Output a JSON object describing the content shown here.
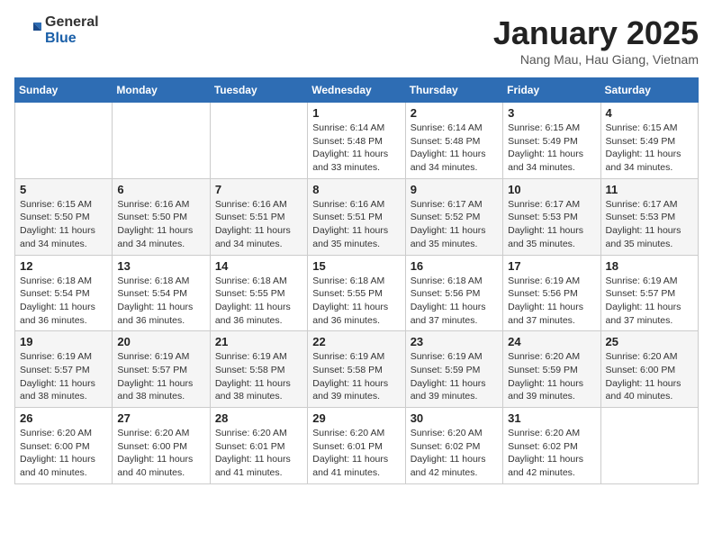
{
  "header": {
    "logo": {
      "general": "General",
      "blue": "Blue"
    },
    "title": "January 2025",
    "subtitle": "Nang Mau, Hau Giang, Vietnam"
  },
  "weekdays": [
    "Sunday",
    "Monday",
    "Tuesday",
    "Wednesday",
    "Thursday",
    "Friday",
    "Saturday"
  ],
  "weeks": [
    [
      {
        "day": "",
        "info": ""
      },
      {
        "day": "",
        "info": ""
      },
      {
        "day": "",
        "info": ""
      },
      {
        "day": "1",
        "info": "Sunrise: 6:14 AM\nSunset: 5:48 PM\nDaylight: 11 hours\nand 33 minutes."
      },
      {
        "day": "2",
        "info": "Sunrise: 6:14 AM\nSunset: 5:48 PM\nDaylight: 11 hours\nand 34 minutes."
      },
      {
        "day": "3",
        "info": "Sunrise: 6:15 AM\nSunset: 5:49 PM\nDaylight: 11 hours\nand 34 minutes."
      },
      {
        "day": "4",
        "info": "Sunrise: 6:15 AM\nSunset: 5:49 PM\nDaylight: 11 hours\nand 34 minutes."
      }
    ],
    [
      {
        "day": "5",
        "info": "Sunrise: 6:15 AM\nSunset: 5:50 PM\nDaylight: 11 hours\nand 34 minutes."
      },
      {
        "day": "6",
        "info": "Sunrise: 6:16 AM\nSunset: 5:50 PM\nDaylight: 11 hours\nand 34 minutes."
      },
      {
        "day": "7",
        "info": "Sunrise: 6:16 AM\nSunset: 5:51 PM\nDaylight: 11 hours\nand 34 minutes."
      },
      {
        "day": "8",
        "info": "Sunrise: 6:16 AM\nSunset: 5:51 PM\nDaylight: 11 hours\nand 35 minutes."
      },
      {
        "day": "9",
        "info": "Sunrise: 6:17 AM\nSunset: 5:52 PM\nDaylight: 11 hours\nand 35 minutes."
      },
      {
        "day": "10",
        "info": "Sunrise: 6:17 AM\nSunset: 5:53 PM\nDaylight: 11 hours\nand 35 minutes."
      },
      {
        "day": "11",
        "info": "Sunrise: 6:17 AM\nSunset: 5:53 PM\nDaylight: 11 hours\nand 35 minutes."
      }
    ],
    [
      {
        "day": "12",
        "info": "Sunrise: 6:18 AM\nSunset: 5:54 PM\nDaylight: 11 hours\nand 36 minutes."
      },
      {
        "day": "13",
        "info": "Sunrise: 6:18 AM\nSunset: 5:54 PM\nDaylight: 11 hours\nand 36 minutes."
      },
      {
        "day": "14",
        "info": "Sunrise: 6:18 AM\nSunset: 5:55 PM\nDaylight: 11 hours\nand 36 minutes."
      },
      {
        "day": "15",
        "info": "Sunrise: 6:18 AM\nSunset: 5:55 PM\nDaylight: 11 hours\nand 36 minutes."
      },
      {
        "day": "16",
        "info": "Sunrise: 6:18 AM\nSunset: 5:56 PM\nDaylight: 11 hours\nand 37 minutes."
      },
      {
        "day": "17",
        "info": "Sunrise: 6:19 AM\nSunset: 5:56 PM\nDaylight: 11 hours\nand 37 minutes."
      },
      {
        "day": "18",
        "info": "Sunrise: 6:19 AM\nSunset: 5:57 PM\nDaylight: 11 hours\nand 37 minutes."
      }
    ],
    [
      {
        "day": "19",
        "info": "Sunrise: 6:19 AM\nSunset: 5:57 PM\nDaylight: 11 hours\nand 38 minutes."
      },
      {
        "day": "20",
        "info": "Sunrise: 6:19 AM\nSunset: 5:57 PM\nDaylight: 11 hours\nand 38 minutes."
      },
      {
        "day": "21",
        "info": "Sunrise: 6:19 AM\nSunset: 5:58 PM\nDaylight: 11 hours\nand 38 minutes."
      },
      {
        "day": "22",
        "info": "Sunrise: 6:19 AM\nSunset: 5:58 PM\nDaylight: 11 hours\nand 39 minutes."
      },
      {
        "day": "23",
        "info": "Sunrise: 6:19 AM\nSunset: 5:59 PM\nDaylight: 11 hours\nand 39 minutes."
      },
      {
        "day": "24",
        "info": "Sunrise: 6:20 AM\nSunset: 5:59 PM\nDaylight: 11 hours\nand 39 minutes."
      },
      {
        "day": "25",
        "info": "Sunrise: 6:20 AM\nSunset: 6:00 PM\nDaylight: 11 hours\nand 40 minutes."
      }
    ],
    [
      {
        "day": "26",
        "info": "Sunrise: 6:20 AM\nSunset: 6:00 PM\nDaylight: 11 hours\nand 40 minutes."
      },
      {
        "day": "27",
        "info": "Sunrise: 6:20 AM\nSunset: 6:00 PM\nDaylight: 11 hours\nand 40 minutes."
      },
      {
        "day": "28",
        "info": "Sunrise: 6:20 AM\nSunset: 6:01 PM\nDaylight: 11 hours\nand 41 minutes."
      },
      {
        "day": "29",
        "info": "Sunrise: 6:20 AM\nSunset: 6:01 PM\nDaylight: 11 hours\nand 41 minutes."
      },
      {
        "day": "30",
        "info": "Sunrise: 6:20 AM\nSunset: 6:02 PM\nDaylight: 11 hours\nand 42 minutes."
      },
      {
        "day": "31",
        "info": "Sunrise: 6:20 AM\nSunset: 6:02 PM\nDaylight: 11 hours\nand 42 minutes."
      },
      {
        "day": "",
        "info": ""
      }
    ]
  ]
}
